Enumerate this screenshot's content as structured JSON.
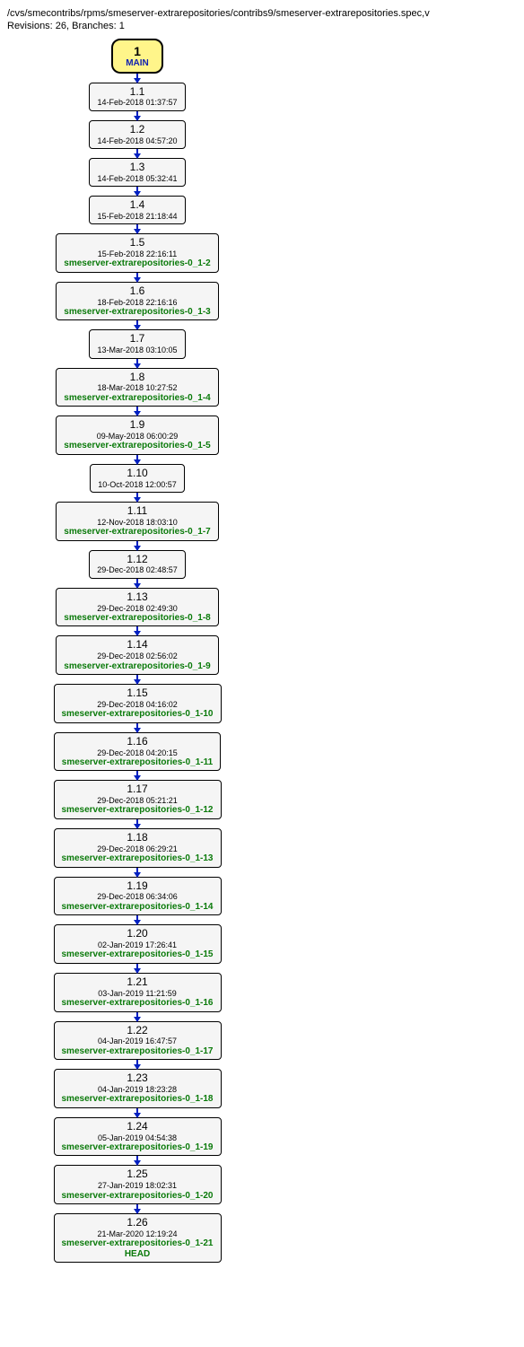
{
  "header": {
    "path": "/cvs/smecontribs/rpms/smeserver-extrarepositories/contribs9/smeserver-extrarepositories.spec,v",
    "meta": "Revisions: 26, Branches: 1"
  },
  "trunk": {
    "num": "1",
    "name": "MAIN"
  },
  "nodes": [
    {
      "rev": "1.1",
      "date": "14-Feb-2018 01:37:57",
      "tags": []
    },
    {
      "rev": "1.2",
      "date": "14-Feb-2018 04:57:20",
      "tags": []
    },
    {
      "rev": "1.3",
      "date": "14-Feb-2018 05:32:41",
      "tags": []
    },
    {
      "rev": "1.4",
      "date": "15-Feb-2018 21:18:44",
      "tags": []
    },
    {
      "rev": "1.5",
      "date": "15-Feb-2018 22:16:11",
      "tags": [
        "smeserver-extrarepositories-0_1-2"
      ]
    },
    {
      "rev": "1.6",
      "date": "18-Feb-2018 22:16:16",
      "tags": [
        "smeserver-extrarepositories-0_1-3"
      ]
    },
    {
      "rev": "1.7",
      "date": "13-Mar-2018 03:10:05",
      "tags": []
    },
    {
      "rev": "1.8",
      "date": "18-Mar-2018 10:27:52",
      "tags": [
        "smeserver-extrarepositories-0_1-4"
      ]
    },
    {
      "rev": "1.9",
      "date": "09-May-2018 06:00:29",
      "tags": [
        "smeserver-extrarepositories-0_1-5"
      ]
    },
    {
      "rev": "1.10",
      "date": "10-Oct-2018 12:00:57",
      "tags": []
    },
    {
      "rev": "1.11",
      "date": "12-Nov-2018 18:03:10",
      "tags": [
        "smeserver-extrarepositories-0_1-7"
      ]
    },
    {
      "rev": "1.12",
      "date": "29-Dec-2018 02:48:57",
      "tags": []
    },
    {
      "rev": "1.13",
      "date": "29-Dec-2018 02:49:30",
      "tags": [
        "smeserver-extrarepositories-0_1-8"
      ]
    },
    {
      "rev": "1.14",
      "date": "29-Dec-2018 02:56:02",
      "tags": [
        "smeserver-extrarepositories-0_1-9"
      ]
    },
    {
      "rev": "1.15",
      "date": "29-Dec-2018 04:16:02",
      "tags": [
        "smeserver-extrarepositories-0_1-10"
      ]
    },
    {
      "rev": "1.16",
      "date": "29-Dec-2018 04:20:15",
      "tags": [
        "smeserver-extrarepositories-0_1-11"
      ]
    },
    {
      "rev": "1.17",
      "date": "29-Dec-2018 05:21:21",
      "tags": [
        "smeserver-extrarepositories-0_1-12"
      ]
    },
    {
      "rev": "1.18",
      "date": "29-Dec-2018 06:29:21",
      "tags": [
        "smeserver-extrarepositories-0_1-13"
      ]
    },
    {
      "rev": "1.19",
      "date": "29-Dec-2018 06:34:06",
      "tags": [
        "smeserver-extrarepositories-0_1-14"
      ]
    },
    {
      "rev": "1.20",
      "date": "02-Jan-2019 17:26:41",
      "tags": [
        "smeserver-extrarepositories-0_1-15"
      ]
    },
    {
      "rev": "1.21",
      "date": "03-Jan-2019 11:21:59",
      "tags": [
        "smeserver-extrarepositories-0_1-16"
      ]
    },
    {
      "rev": "1.22",
      "date": "04-Jan-2019 16:47:57",
      "tags": [
        "smeserver-extrarepositories-0_1-17"
      ]
    },
    {
      "rev": "1.23",
      "date": "04-Jan-2019 18:23:28",
      "tags": [
        "smeserver-extrarepositories-0_1-18"
      ]
    },
    {
      "rev": "1.24",
      "date": "05-Jan-2019 04:54:38",
      "tags": [
        "smeserver-extrarepositories-0_1-19"
      ]
    },
    {
      "rev": "1.25",
      "date": "27-Jan-2019 18:02:31",
      "tags": [
        "smeserver-extrarepositories-0_1-20"
      ]
    },
    {
      "rev": "1.26",
      "date": "21-Mar-2020 12:19:24",
      "tags": [
        "smeserver-extrarepositories-0_1-21",
        "HEAD"
      ]
    }
  ]
}
